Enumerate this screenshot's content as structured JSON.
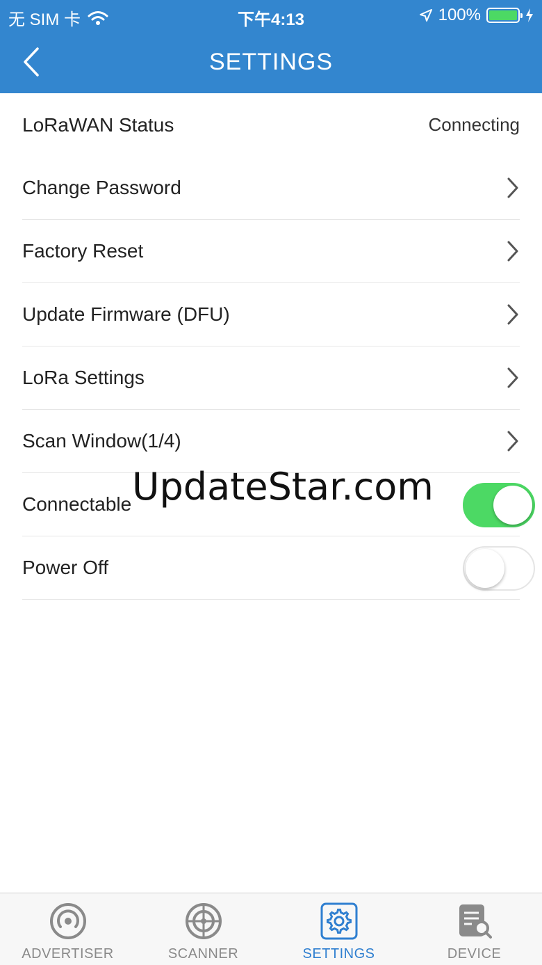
{
  "status_bar": {
    "carrier": "无 SIM 卡",
    "time": "下午4:13",
    "battery": "100%"
  },
  "header": {
    "title": "SETTINGS",
    "back_icon": "chevron-left-icon"
  },
  "settings": {
    "lorawan_status": {
      "label": "LoRaWAN Status",
      "value": "Connecting"
    },
    "items": [
      {
        "label": "Change Password"
      },
      {
        "label": "Factory Reset"
      },
      {
        "label": "Update Firmware (DFU)"
      },
      {
        "label": "LoRa Settings"
      },
      {
        "label": "Scan Window(1/4)"
      }
    ],
    "connectable": {
      "label": "Connectable",
      "on": true
    },
    "power_off": {
      "label": "Power Off",
      "on": false
    }
  },
  "watermark": "UpdateStar.com",
  "tabbar": {
    "tabs": [
      {
        "label": "ADVERTISER",
        "icon": "broadcast-icon",
        "active": false
      },
      {
        "label": "SCANNER",
        "icon": "target-icon",
        "active": false
      },
      {
        "label": "SETTINGS",
        "icon": "gear-icon",
        "active": true
      },
      {
        "label": "DEVICE",
        "icon": "device-search-icon",
        "active": false
      }
    ]
  },
  "colors": {
    "header": "#3386cf",
    "toggle_on": "#4cd964",
    "tab_active": "#2f7fd0",
    "tab_inactive": "#8a8a8a"
  }
}
